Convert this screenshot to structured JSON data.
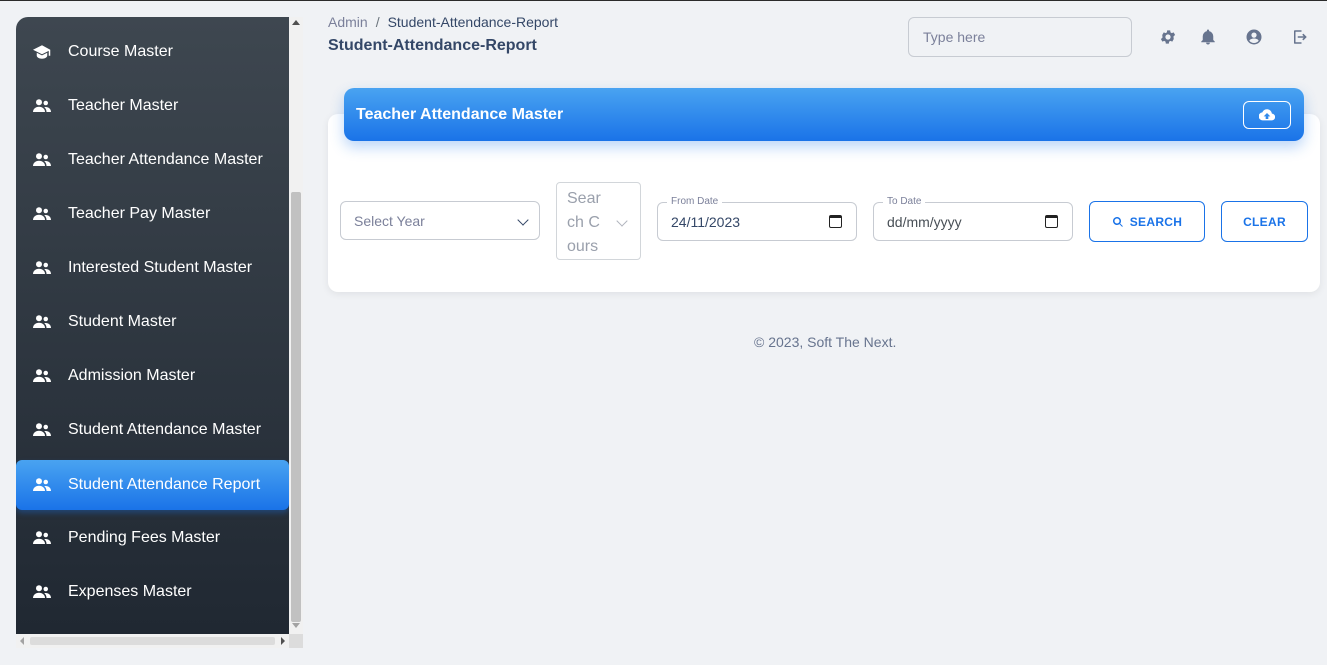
{
  "sidebar": {
    "items": [
      {
        "label": "Course Master",
        "icon": "graduation-cap-icon",
        "active": false
      },
      {
        "label": "Teacher Master",
        "icon": "users-icon",
        "active": false
      },
      {
        "label": "Teacher Attendance Master",
        "icon": "users-icon",
        "active": false
      },
      {
        "label": "Teacher Pay Master",
        "icon": "users-icon",
        "active": false
      },
      {
        "label": "Interested Student Master",
        "icon": "users-icon",
        "active": false
      },
      {
        "label": "Student Master",
        "icon": "users-icon",
        "active": false
      },
      {
        "label": "Admission Master",
        "icon": "users-icon",
        "active": false
      },
      {
        "label": "Student Attendance Master",
        "icon": "users-icon",
        "active": false
      },
      {
        "label": "Student Attendance Report",
        "icon": "users-icon",
        "active": true
      },
      {
        "label": "Pending Fees Master",
        "icon": "users-icon",
        "active": false
      },
      {
        "label": "Expenses Master",
        "icon": "users-icon",
        "active": false
      }
    ]
  },
  "header": {
    "breadcrumb": {
      "root": "Admin",
      "separator": "/",
      "current": "Student-Attendance-Report"
    },
    "title": "Student-Attendance-Report",
    "search_placeholder": "Type here",
    "icons": [
      "gear-icon",
      "bell-icon",
      "user-circle-icon",
      "logout-icon"
    ]
  },
  "card": {
    "title": "Teacher Attendance Master",
    "upload_icon": "cloud-upload-icon",
    "year_select": {
      "placeholder": "Select Year"
    },
    "course_select": {
      "placeholder": "Search Course Name"
    },
    "from_date": {
      "label": "From Date",
      "value": "24/11/2023"
    },
    "to_date": {
      "label": "To Date",
      "value": "dd/mm/yyyy"
    },
    "search_button": "SEARCH",
    "clear_button": "CLEAR"
  },
  "footer": {
    "text": "© 2023, Soft The Next."
  },
  "colors": {
    "accent": "#1a73e8",
    "accent_light": "#49a3f1",
    "sidebar_top": "#3e4750",
    "sidebar_bottom": "#202832",
    "background": "#f0f2f5"
  }
}
